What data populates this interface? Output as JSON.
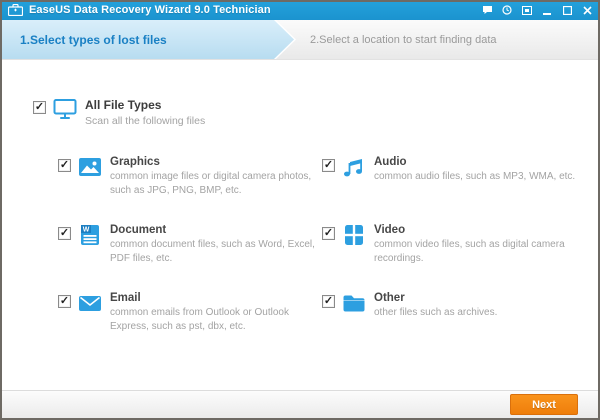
{
  "colors": {
    "titlebar_blue": "#1b93cf",
    "accent_blue": "#2d9fe0",
    "step1_text_blue": "#1a80c4",
    "next_orange": "#ef7e0b",
    "frame_gray": "#6e6a64"
  },
  "titlebar": {
    "app_title": "EaseUS Data Recovery Wizard 9.0 Technician",
    "icons": [
      "toolbox-app-icon",
      "chat-icon",
      "history-clock-icon",
      "popup-window-icon",
      "minimize-icon",
      "maximize-icon",
      "close-icon"
    ]
  },
  "steps": {
    "step1_label": "1.Select types of lost files",
    "step2_label": "2.Select a location to start finding data"
  },
  "check_glyph": "✓",
  "all_file_types": {
    "title": "All File Types",
    "desc": "Scan all the following files",
    "checked": true,
    "icon": "monitor-icon"
  },
  "file_types": [
    {
      "title": "Graphics",
      "desc": "common image files or digital camera photos, such as JPG, PNG, BMP, etc.",
      "checked": true,
      "icon": "image-icon"
    },
    {
      "title": "Audio",
      "desc": "common audio files, such as MP3, WMA, etc.",
      "checked": true,
      "icon": "music-note-icon"
    },
    {
      "title": "Document",
      "desc": "common document files, such as Word, Excel, PDF files, etc.",
      "checked": true,
      "icon": "word-document-icon",
      "badge_letter": "W"
    },
    {
      "title": "Video",
      "desc": "common video files, such as digital camera recordings.",
      "checked": true,
      "icon": "film-icon"
    },
    {
      "title": "Email",
      "desc": "common emails from Outlook or Outlook Express, such as pst, dbx, etc.",
      "checked": true,
      "icon": "envelope-icon"
    },
    {
      "title": "Other",
      "desc": "other files such as archives.",
      "checked": true,
      "icon": "folder-icon"
    }
  ],
  "footer": {
    "next_label": "Next"
  }
}
